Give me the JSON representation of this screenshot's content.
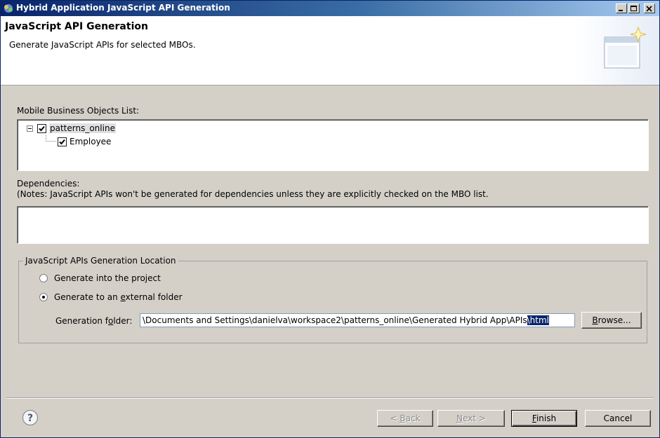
{
  "window": {
    "title": "Hybrid Application JavaScript API Generation"
  },
  "header": {
    "title": "JavaScript API Generation",
    "description": "Generate JavaScript APIs for selected MBOs."
  },
  "mbo_list": {
    "label": "Mobile Business Objects List:",
    "items": [
      {
        "label": "patterns_online",
        "checked": true,
        "expanded": true
      },
      {
        "label": "Employee",
        "checked": true
      }
    ]
  },
  "dependencies": {
    "label": "Dependencies:",
    "note": "(Notes: JavaScript APIs won't be generated for dependencies unless they are explicitly checked on the MBO list."
  },
  "location": {
    "group_title": "JavaScript APIs Generation Location",
    "option_project": "Generate into the project",
    "option_external_pre": "Generate to an ",
    "option_external_accel": "e",
    "option_external_post": "xternal folder",
    "selected": "external",
    "folder_label_pre": "Generation f",
    "folder_label_accel": "o",
    "folder_label_post": "lder:",
    "folder_value_plain": "\\Documents and Settings\\danielva\\workspace2\\patterns_online\\Generated Hybrid App\\APIs",
    "folder_value_selected": "\\html",
    "browse_accel": "B",
    "browse_rest": "rowse..."
  },
  "buttons": {
    "back_pre": "< ",
    "back_accel": "B",
    "back_post": "ack",
    "next_accel": "N",
    "next_post": "ext >",
    "finish_accel": "F",
    "finish_post": "inish",
    "cancel": "Cancel"
  },
  "colors": {
    "titlebar": "#0a246a",
    "selection": "#0a246a",
    "dialog": "#d4d0c8"
  },
  "icons": [
    "app-icon",
    "minimize-icon",
    "maximize-icon",
    "close-icon",
    "wizard-banner-icon",
    "help-icon"
  ]
}
